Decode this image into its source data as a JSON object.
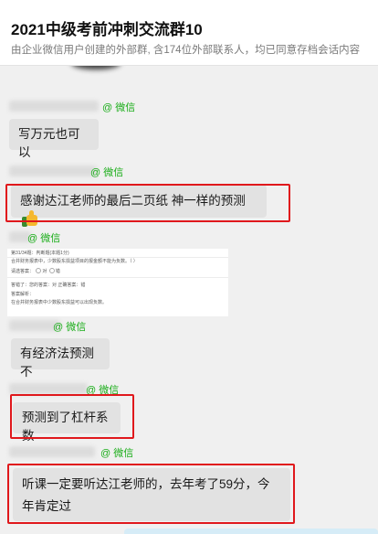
{
  "header": {
    "title": "2021中级考前冲刺交流群10",
    "subtitle": "由企业微信用户创建的外部群, 含174位外部联系人，均已同意存档会话内容"
  },
  "wechat_tag": "@ 微信",
  "messages": [
    {
      "text": "写万元也可以"
    },
    {
      "text": "感谢达江老师的最后二页纸 神一样的预测",
      "emoji": "thumbs-up"
    },
    {
      "text": "有经济法预测不"
    },
    {
      "text": "预测到了杠杆系数"
    },
    {
      "text": "听课一定要听达江老师的，去年考了59分，今年肯定过"
    }
  ],
  "quiz_image": {
    "line1": "第31/34题：判断题(本题1分)",
    "line2": "合并财务报表中，少数股东损益项目的报金额不能为负数。（ ）",
    "line3": "请选答案：",
    "opt_true": "对",
    "opt_false": "错",
    "line4": "答错了：您的答案：对   正确答案：错",
    "line5": "答案解析：",
    "line6": "在合并财务报表中少数股东损益可以出现负数。"
  }
}
